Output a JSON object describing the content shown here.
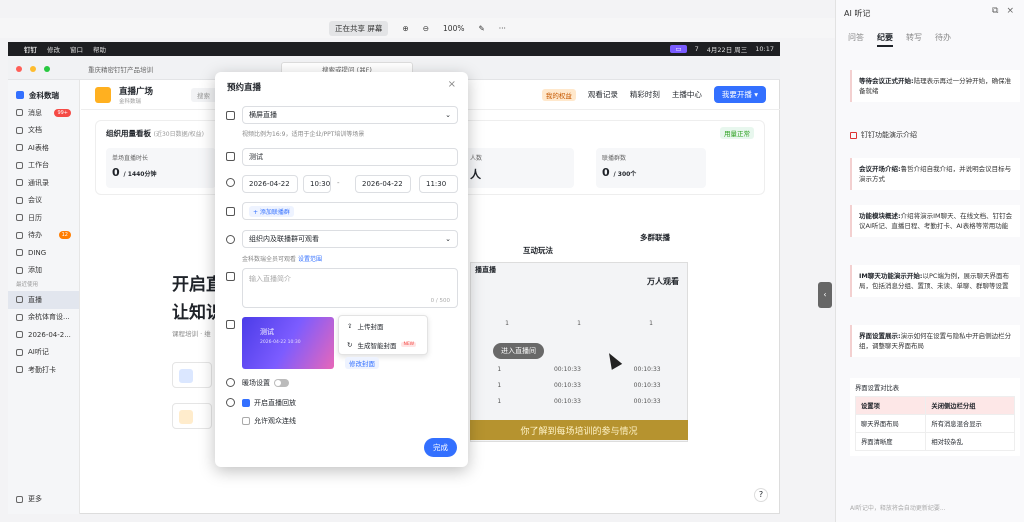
{
  "share": {
    "status": "正在共享 屏幕",
    "zoom": "100%",
    "dots": "···"
  },
  "mac": {
    "app": "钉钉",
    "menu": [
      "修改",
      "窗口",
      "帮助"
    ],
    "date": "4月22日 周三",
    "time": "10:17",
    "badge": "7"
  },
  "window": {
    "breadcrumb": "重庆精密钉钉产品培训",
    "search": "搜索或提问 (⌘F)"
  },
  "sidebar": {
    "team": "金科数瑞",
    "items": [
      {
        "label": "消息",
        "badge": "99+"
      },
      {
        "label": "文档"
      },
      {
        "label": "AI表格"
      },
      {
        "label": "工作台"
      },
      {
        "label": "通讯录"
      },
      {
        "label": "会议"
      },
      {
        "label": "日历"
      },
      {
        "label": "待办",
        "badge": "12"
      },
      {
        "label": "DING"
      },
      {
        "label": "添加"
      }
    ],
    "recent_label": "最近使用",
    "recent": [
      {
        "label": "直播"
      },
      {
        "label": "余杭体育设..."
      },
      {
        "label": "2026-04-2..."
      },
      {
        "label": "AI听记"
      },
      {
        "label": "考勤打卡"
      }
    ],
    "more": "更多"
  },
  "main": {
    "title": "直播广场",
    "subtitle": "金科数瑞",
    "search": "搜索",
    "rights": "我的权益",
    "nav": [
      "观看记录",
      "精彩时刻",
      "主播中心"
    ],
    "start_btn": "我要开播 ▾"
  },
  "dashboard": {
    "title": "组织用量看板",
    "note": "(近30日数据/权益)",
    "status": "用量正常",
    "stats": [
      {
        "label": "单场直播时长",
        "value": "0",
        "unit": "/ 1440分钟"
      },
      {
        "label": "人数",
        "value": "人",
        "unit": ""
      },
      {
        "label": "联播群数",
        "value": "0",
        "unit": "/ 300个"
      }
    ]
  },
  "hero": {
    "line1": "开启直",
    "line2": "让知识",
    "line3": "课程培训 · 维"
  },
  "preview": {
    "interact": "互动玩法",
    "multigroup": "多群联播",
    "tenk": "万人观看",
    "live_label": "播直播",
    "enter": "进入直播间",
    "subtitle": "你了解到每场培训的参与情况",
    "row_num": "1",
    "time": "00:10:33"
  },
  "modal": {
    "title": "预约直播",
    "mode": "横屏直播",
    "mode_hint": "视频比例为16:9，适用于企业/PPT培训等场景",
    "name": "测试",
    "start_date": "2026-04-22",
    "start_time": "10:30",
    "sep": "-",
    "end_date": "2026-04-22",
    "end_time": "11:30",
    "cohost_btn": "+ 添加联播群",
    "visibility": "组织内及联播群可观看",
    "vis_hint": "金科数瑞全员可观看",
    "vis_link": "设置范围",
    "desc_placeholder": "输入直播简介",
    "desc_count": "0 / 500",
    "cover_text": "测试",
    "cover_date": "2026-04-22 10:30",
    "menu_upload": "上传封面",
    "menu_ai": "生成智能封面",
    "new_tag": "NEW",
    "modify_cover": "修改封面",
    "warmup": "暖场设置",
    "replay": "开启直播回放",
    "mic": "允许观众连线",
    "done": "完成"
  },
  "ai_panel": {
    "title": "AI 听记",
    "tabs": [
      "问答",
      "纪要",
      "转写",
      "待办"
    ],
    "active_tab": "纪要",
    "section": "钉钉功能演示介绍",
    "notes": [
      {
        "head": "等待会议正式开始:",
        "body": "陆理表示再过一分钟开始，确保准备就绪"
      },
      {
        "head": "会议开场介绍:",
        "body": "鲁哲介绍自我介绍，并说明会议目标与演示方式"
      },
      {
        "head": "功能模块概述:",
        "body": "介绍将演示IM聊天、在线文档、钉钉会议AI听记、直播日程、考勤打卡、AI表格等常用功能"
      },
      {
        "head": "IM聊天功能演示开始:",
        "body": "以PC端为例，展示聊天界面布局，包括消息分组、置顶、未读、单聊、群聊等设置"
      },
      {
        "head": "界面设置展示:",
        "body": "演示如何在设置与隐私中开启侧边栏分组，调整聊天界面布局"
      }
    ],
    "table_title": "界面设置对比表",
    "table": [
      [
        "设置项",
        "关闭侧边栏分组"
      ],
      [
        "聊天界面布局",
        "所有消息混合显示"
      ],
      [
        "界面清晰度",
        "相对较杂乱"
      ]
    ],
    "input_hint": "AI听记中，释放将会自动更新纪要..."
  },
  "icons": [
    "search-icon",
    "close-icon",
    "chevron-down-icon",
    "calendar-icon",
    "clock-icon",
    "eye-icon",
    "gear-icon",
    "upload-icon",
    "refresh-icon",
    "help-icon"
  ]
}
